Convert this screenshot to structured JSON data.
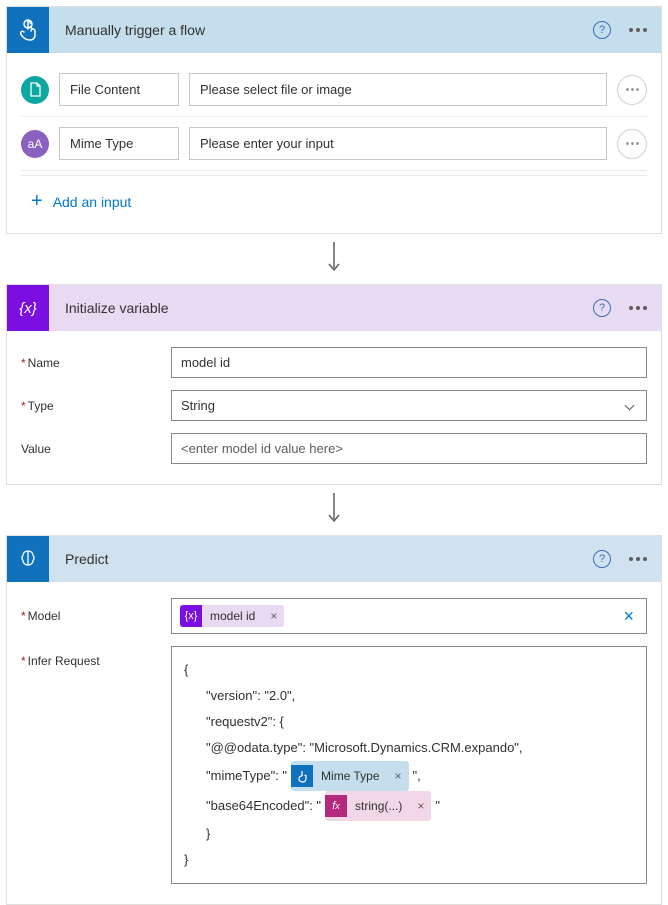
{
  "trigger": {
    "title": "Manually trigger a flow",
    "inputs": [
      {
        "icon": "doc",
        "label": "File Content",
        "placeholder": "Please select file or image"
      },
      {
        "icon": "text",
        "label": "Mime Type",
        "placeholder": "Please enter your input"
      }
    ],
    "add_label": "Add an input"
  },
  "variable": {
    "title": "Initialize variable",
    "name_label": "Name",
    "name_value": "model id",
    "type_label": "Type",
    "type_value": "String",
    "value_label": "Value",
    "value_placeholder": "<enter model id value here>"
  },
  "predict": {
    "title": "Predict",
    "model_label": "Model",
    "model_chip": "model id",
    "infer_label": "Infer Request",
    "json": {
      "l1": "{",
      "l2": "\"version\": \"2.0\",",
      "l3": "\"requestv2\": {",
      "l4": "\"@@odata.type\": \"Microsoft.Dynamics.CRM.expando\",",
      "l5_pre": "\"mimeType\": \"",
      "l5_chip": "Mime Type",
      "l5_post": "\",",
      "l6_pre": "\"base64Encoded\": \"",
      "l6_chip": "string(...)",
      "l6_post": "\"",
      "l7": "}",
      "l8": "}"
    }
  }
}
